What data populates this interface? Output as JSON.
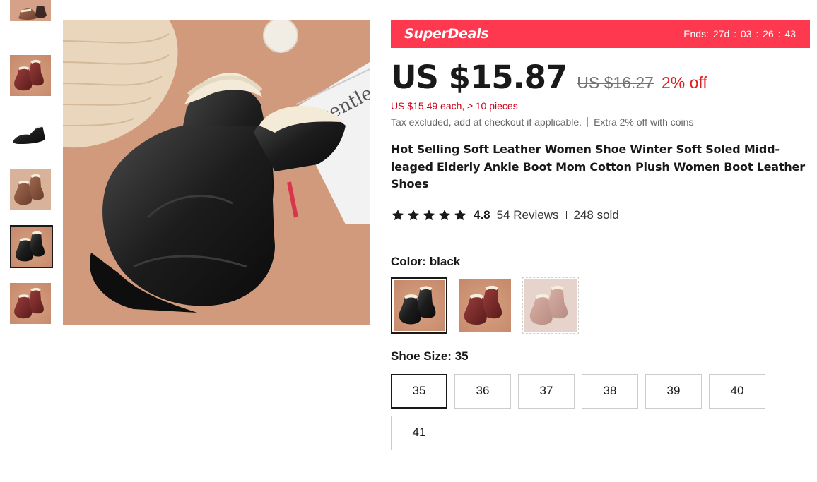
{
  "thumbnails": [
    {
      "icon": "boot-thumbnail-brown",
      "selected": false
    },
    {
      "icon": "boot-thumbnail-red",
      "selected": false
    },
    {
      "icon": "boot-thumbnail-black",
      "selected": false
    },
    {
      "icon": "boot-thumbnail-brown-pair",
      "selected": false
    },
    {
      "icon": "boot-thumbnail-black-pair",
      "selected": true
    },
    {
      "icon": "boot-thumbnail-red-pair",
      "selected": false
    }
  ],
  "main_image": {
    "icon": "black-winter-boots-photo"
  },
  "superdeals": {
    "brand": "SuperDeals",
    "ends_label": "Ends:",
    "days": "27d",
    "hours": "03",
    "minutes": "26",
    "seconds": "43",
    "sep": ":",
    "color": "#fd384f"
  },
  "price": {
    "current": "US $15.87",
    "original": "US $16.27",
    "discount": "2% off",
    "bulk": "US $15.49 each, ≥ 10 pieces",
    "tax_note": "Tax excluded, add at checkout if applicable.",
    "coins_note": "Extra 2% off with coins"
  },
  "product": {
    "title": "Hot Selling Soft Leather Women Shoe Winter Soft Soled Midd-leaged Elderly Ankle Boot Mom Cotton Plush Women Boot Leather Shoes",
    "rating": "4.8",
    "stars": 5,
    "reviews": "54 Reviews",
    "sold": "248 sold"
  },
  "color": {
    "label": "Color: ",
    "value": "black",
    "options": [
      {
        "icon": "swatch-black",
        "selected": true
      },
      {
        "icon": "swatch-wine-red",
        "selected": false
      },
      {
        "icon": "swatch-pink",
        "selected": false
      }
    ]
  },
  "size": {
    "label": "Shoe Size: ",
    "value": "35",
    "options": [
      "35",
      "36",
      "37",
      "38",
      "39",
      "40",
      "41"
    ],
    "selected": "35"
  }
}
